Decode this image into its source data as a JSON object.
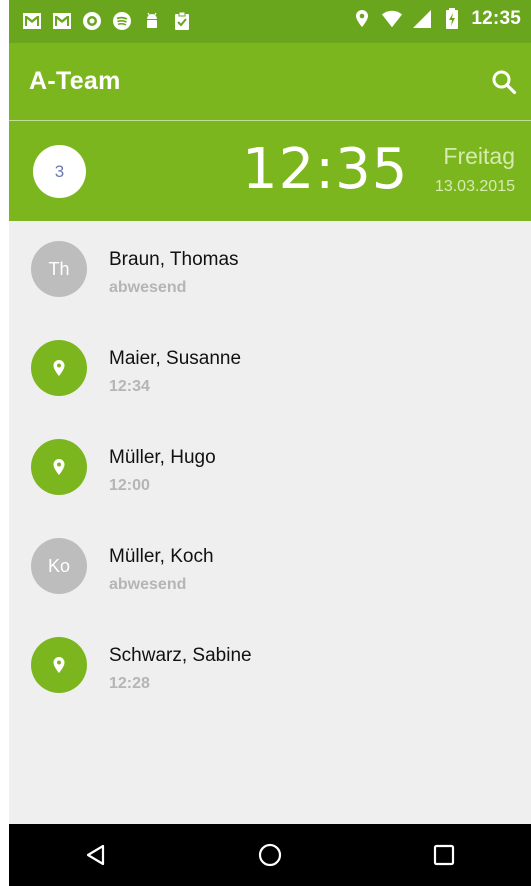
{
  "status_bar": {
    "time": "12:35",
    "left_icons": [
      "gmail-icon",
      "gmail-icon",
      "app-icon",
      "spotify-icon",
      "android-icon",
      "clipboard-check-icon"
    ],
    "right_icons": [
      "location-icon",
      "wifi-icon",
      "signal-icon",
      "battery-icon"
    ]
  },
  "app_bar": {
    "title": "A-Team",
    "search_icon": "search-icon"
  },
  "header": {
    "count": "3",
    "time": "12:35",
    "day": "Freitag",
    "date": "13.03.2015"
  },
  "people": [
    {
      "name": "Braun, Thomas",
      "status": "abwesend",
      "avatar_text": "Th",
      "avatar_type": "initials"
    },
    {
      "name": "Maier, Susanne",
      "status": "12:34",
      "avatar_text": "",
      "avatar_type": "location"
    },
    {
      "name": "Müller, Hugo",
      "status": "12:00",
      "avatar_text": "",
      "avatar_type": "location"
    },
    {
      "name": "Müller, Koch",
      "status": "abwesend",
      "avatar_text": "Ko",
      "avatar_type": "initials"
    },
    {
      "name": "Schwarz, Sabine",
      "status": "12:28",
      "avatar_text": "",
      "avatar_type": "location"
    }
  ],
  "nav_bar": {
    "buttons": [
      "back-icon",
      "home-icon",
      "recents-icon"
    ]
  },
  "colors": {
    "primary": "#7cb61f",
    "status_bar": "#6aa51e",
    "avatar_gray": "#bdbdbd",
    "background": "#efefef"
  }
}
